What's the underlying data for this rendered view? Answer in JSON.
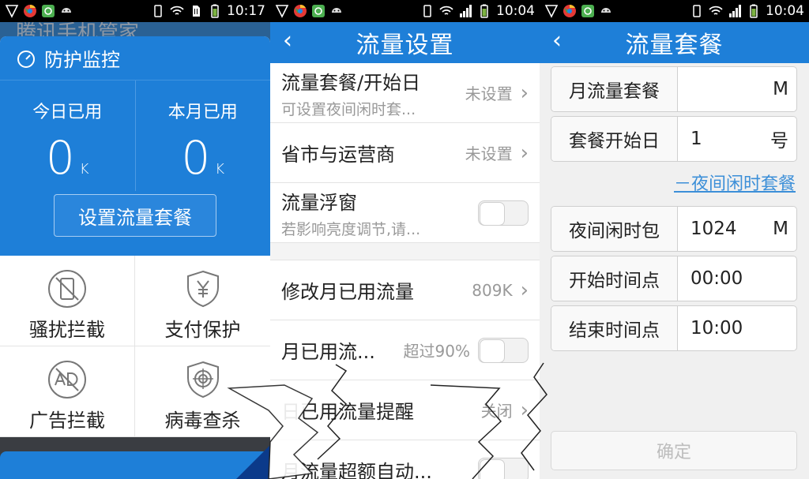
{
  "status_bars": [
    {
      "time": "10:17"
    },
    {
      "time": "10:04"
    },
    {
      "time": "10:04"
    }
  ],
  "panel1": {
    "under_title": "腾讯手机管家",
    "header_title": "防护监控",
    "stats": [
      {
        "label": "今日已用",
        "value": "0",
        "unit": "K"
      },
      {
        "label": "本月已用",
        "value": "0",
        "unit": "K"
      }
    ],
    "setup_button": "设置流量套餐",
    "tiles": [
      {
        "label": "骚扰拦截",
        "icon": "phone-block-icon"
      },
      {
        "label": "支付保护",
        "icon": "yen-shield-icon"
      },
      {
        "label": "广告拦截",
        "icon": "ad-block-icon"
      },
      {
        "label": "病毒查杀",
        "icon": "virus-scan-icon"
      }
    ]
  },
  "panel2": {
    "title": "流量设置",
    "rows": [
      {
        "main": "流量套餐/开始日",
        "sub": "可设置夜间闲时套...",
        "value": "未设置"
      },
      {
        "main": "省市与运营商",
        "value": "未设置"
      },
      {
        "main": "流量浮窗",
        "sub": "若影响亮度调节,请..."
      },
      {
        "main": "修改月已用流量",
        "value": "809K"
      },
      {
        "main": "月已用流...",
        "value": "超过90%"
      },
      {
        "main": "日已用流量提醒",
        "value": "关闭"
      },
      {
        "main": "月流量超额自动..."
      }
    ]
  },
  "panel3": {
    "title": "流量套餐",
    "fields": [
      {
        "label": "月流量套餐",
        "value": "",
        "unit": "M"
      },
      {
        "label": "套餐开始日",
        "value": "1",
        "unit": "号"
      }
    ],
    "night_link": "－夜间闲时套餐",
    "night_fields": [
      {
        "label": "夜间闲时包",
        "value": "1024",
        "unit": "M"
      },
      {
        "label": "开始时间点",
        "value": "00:00",
        "unit": ""
      },
      {
        "label": "结束时间点",
        "value": "10:00",
        "unit": ""
      }
    ],
    "confirm_button": "确定"
  },
  "colors": {
    "accent": "#1e7fd8",
    "link": "#3c8fd8"
  }
}
